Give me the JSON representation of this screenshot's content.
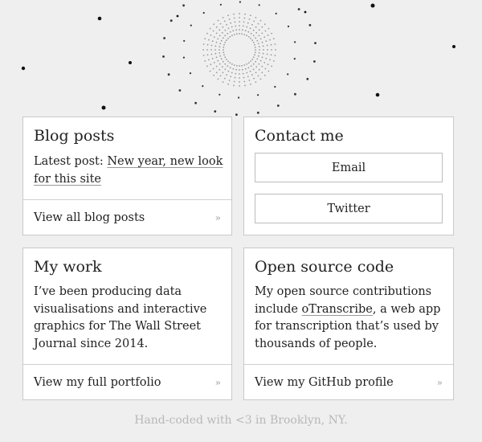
{
  "cards": {
    "blog": {
      "title": "Blog posts",
      "latest_prefix": "Latest post: ",
      "latest_link": "New year, new look for this site",
      "footer": "View all blog posts",
      "chevron": "»"
    },
    "contact": {
      "title": "Contact me",
      "email_label": "Email",
      "twitter_label": "Twitter"
    },
    "work": {
      "title": "My work",
      "body": "I’ve been producing data visualisations and interactive graphics for The Wall Street Journal since 2014.",
      "footer": "View my full portfolio",
      "chevron": "»"
    },
    "opensource": {
      "title": "Open source code",
      "body_prefix": "My open source contributions include ",
      "body_link": "oTranscribe",
      "body_suffix": ", a web app for transcription that’s used by thousands of people.",
      "footer": "View my GitHub profile",
      "chevron": "»"
    }
  },
  "footer_tagline": "Hand-coded with <3 in Brooklyn, NY.",
  "colors": {
    "background": "#efefef",
    "card": "#ffffff",
    "border": "#c9c9c9",
    "muted": "#b8b8b8"
  },
  "decoration": {
    "name": "starburst",
    "icon": "sunburst-dots-icon"
  }
}
